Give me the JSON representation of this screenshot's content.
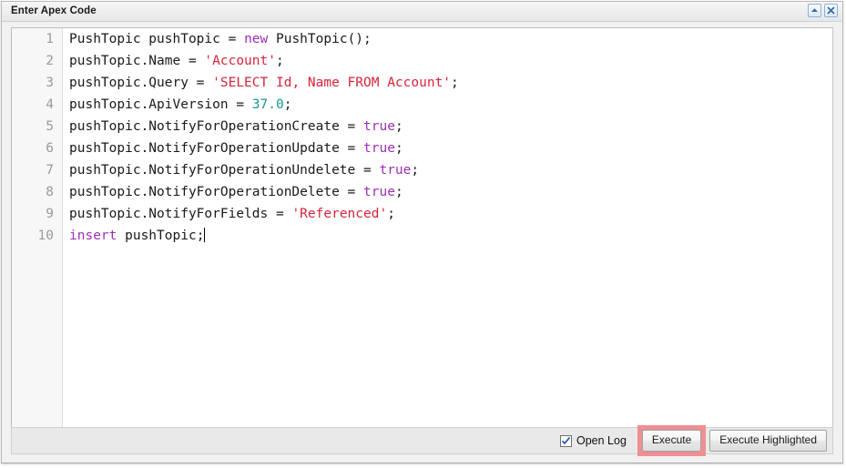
{
  "window": {
    "title": "Enter Apex Code",
    "buttons": [
      {
        "name": "collapse-button",
        "icon": "collapse-up-icon",
        "label": "Collapse"
      },
      {
        "name": "close-button",
        "icon": "close-x-icon",
        "label": "Close"
      }
    ]
  },
  "editor": {
    "line_numbers": [
      "1",
      "2",
      "3",
      "4",
      "5",
      "6",
      "7",
      "8",
      "9",
      "10"
    ],
    "lines": [
      {
        "n": "1",
        "tokens": [
          {
            "t": "PushTopic pushTopic = ",
            "c": "plain"
          },
          {
            "t": "new",
            "c": "kw"
          },
          {
            "t": " PushTopic();",
            "c": "plain"
          }
        ]
      },
      {
        "n": "2",
        "tokens": [
          {
            "t": "pushTopic.Name = ",
            "c": "plain"
          },
          {
            "t": "'Account'",
            "c": "str"
          },
          {
            "t": ";",
            "c": "plain"
          }
        ]
      },
      {
        "n": "3",
        "tokens": [
          {
            "t": "pushTopic.Query = ",
            "c": "plain"
          },
          {
            "t": "'SELECT Id, Name FROM Account'",
            "c": "str"
          },
          {
            "t": ";",
            "c": "plain"
          }
        ]
      },
      {
        "n": "4",
        "tokens": [
          {
            "t": "pushTopic.ApiVersion = ",
            "c": "plain"
          },
          {
            "t": "37.0",
            "c": "num"
          },
          {
            "t": ";",
            "c": "plain"
          }
        ]
      },
      {
        "n": "5",
        "tokens": [
          {
            "t": "pushTopic.NotifyForOperationCreate = ",
            "c": "plain"
          },
          {
            "t": "true",
            "c": "kw"
          },
          {
            "t": ";",
            "c": "plain"
          }
        ]
      },
      {
        "n": "6",
        "tokens": [
          {
            "t": "pushTopic.NotifyForOperationUpdate = ",
            "c": "plain"
          },
          {
            "t": "true",
            "c": "kw"
          },
          {
            "t": ";",
            "c": "plain"
          }
        ]
      },
      {
        "n": "7",
        "tokens": [
          {
            "t": "pushTopic.NotifyForOperationUndelete = ",
            "c": "plain"
          },
          {
            "t": "true",
            "c": "kw"
          },
          {
            "t": ";",
            "c": "plain"
          }
        ]
      },
      {
        "n": "8",
        "tokens": [
          {
            "t": "pushTopic.NotifyForOperationDelete = ",
            "c": "plain"
          },
          {
            "t": "true",
            "c": "kw"
          },
          {
            "t": ";",
            "c": "plain"
          }
        ]
      },
      {
        "n": "9",
        "tokens": [
          {
            "t": "pushTopic.NotifyForFields = ",
            "c": "plain"
          },
          {
            "t": "'Referenced'",
            "c": "str"
          },
          {
            "t": ";",
            "c": "plain"
          }
        ]
      },
      {
        "n": "10",
        "tokens": [
          {
            "t": "insert",
            "c": "kw"
          },
          {
            "t": " pushTopic;",
            "c": "plain"
          }
        ],
        "caret": true
      }
    ]
  },
  "footer": {
    "open_log": {
      "label": "Open Log",
      "checked": true
    },
    "execute_label": "Execute",
    "execute_highlighted_label": "Execute Highlighted"
  },
  "colors": {
    "keyword": "#9b30b5",
    "string": "#d6243a",
    "number": "#139a8c",
    "plain_text": "#1a1a1a",
    "gutter_number": "#9a9a9a",
    "highlight_box": "#ef8f93",
    "titlebar_bg": "#eeeeee",
    "footer_bg": "#e9e9e9"
  }
}
